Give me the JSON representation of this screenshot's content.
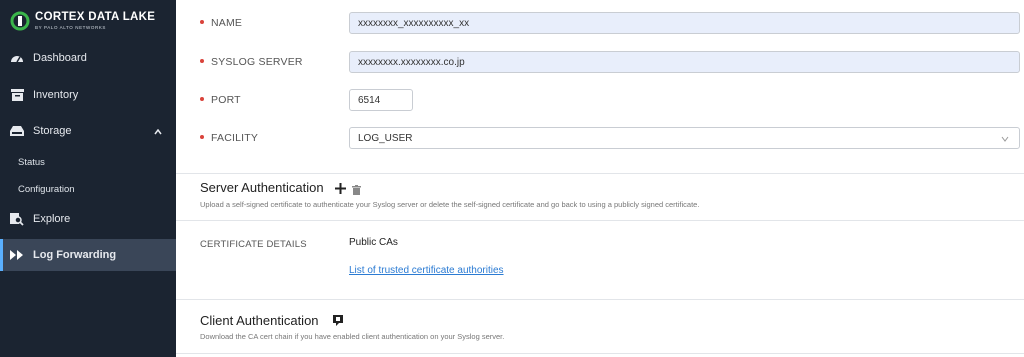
{
  "brand": {
    "title": "CORTEX DATA LAKE",
    "subtitle": "BY PALO ALTO NETWORKS",
    "accent": "#3bb54a"
  },
  "sidebar": {
    "items": [
      {
        "label": "Dashboard",
        "icon": "gauge-icon"
      },
      {
        "label": "Inventory",
        "icon": "inventory-icon"
      },
      {
        "label": "Storage",
        "icon": "storage-icon"
      },
      {
        "label": "Explore",
        "icon": "explore-icon"
      },
      {
        "label": "Log Forwarding",
        "icon": "forward-icon"
      }
    ],
    "subitems": [
      {
        "label": "Status"
      },
      {
        "label": "Configuration"
      }
    ]
  },
  "form": {
    "name": {
      "label": "NAME",
      "value": "xxxxxxxx_xxxxxxxxxx_xx"
    },
    "syslog": {
      "label": "SYSLOG SERVER",
      "value": "xxxxxxxx.xxxxxxxx.co.jp"
    },
    "port": {
      "label": "PORT",
      "value": "6514"
    },
    "facility": {
      "label": "FACILITY",
      "value": "LOG_USER"
    }
  },
  "server_auth": {
    "title": "Server Authentication",
    "desc": "Upload a self-signed certificate to authenticate your Syslog server or delete the self-signed certificate and go back to using a publicly signed certificate.",
    "cert_label": "CERTIFICATE DETAILS",
    "cert_value": "Public CAs",
    "link": "List of trusted certificate authorities"
  },
  "client_auth": {
    "title": "Client Authentication",
    "desc": "Download the CA cert chain if you have enabled client authentication on your Syslog server."
  },
  "colors": {
    "sidebar_bg": "#1b2431",
    "active_bg": "#3a4658",
    "active_border": "#5ab0ff",
    "required_dot": "#d9433b",
    "link": "#2b7bd3"
  }
}
